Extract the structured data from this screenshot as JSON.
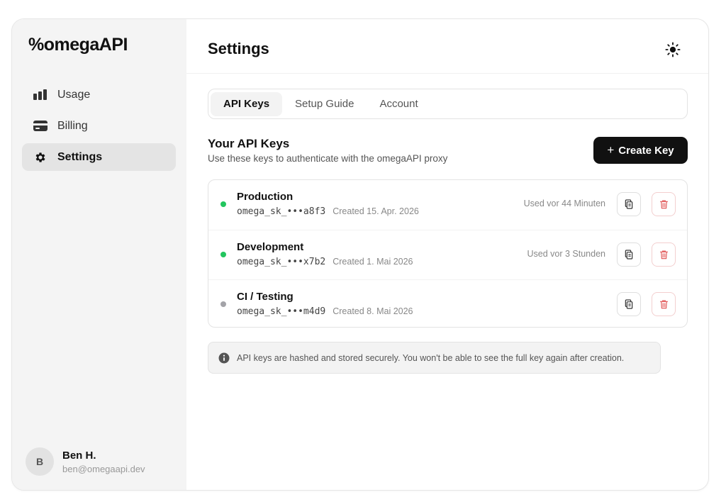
{
  "app": {
    "logo": "%omegaAPI"
  },
  "sidebar": {
    "items": [
      {
        "label": "Usage",
        "icon": "bar-chart-icon",
        "active": false
      },
      {
        "label": "Billing",
        "icon": "credit-card-icon",
        "active": false
      },
      {
        "label": "Settings",
        "icon": "gear-icon",
        "active": true
      }
    ],
    "user": {
      "initial": "B",
      "name": "Ben H.",
      "email": "ben@omegaapi.dev"
    }
  },
  "header": {
    "title": "Settings",
    "theme_icon": "sun-icon"
  },
  "tabs": [
    {
      "label": "API Keys",
      "active": true
    },
    {
      "label": "Setup Guide",
      "active": false
    },
    {
      "label": "Account",
      "active": false
    }
  ],
  "api_keys": {
    "title": "Your API Keys",
    "subtitle": "Use these keys to authenticate with the omegaAPI proxy",
    "create_label": "Create Key",
    "create_icon": "+",
    "keys": [
      {
        "name": "Production",
        "mask": "omega_sk_•••a8f3",
        "created": "Created 15. Apr. 2026",
        "used": "Used vor 44 Minuten",
        "status_color": "#22c55e"
      },
      {
        "name": "Development",
        "mask": "omega_sk_•••x7b2",
        "created": "Created 1. Mai 2026",
        "used": "Used vor 3 Stunden",
        "status_color": "#22c55e"
      },
      {
        "name": "CI / Testing",
        "mask": "omega_sk_•••m4d9",
        "created": "Created 8. Mai 2026",
        "used": "",
        "status_color": "#a3a3a8"
      }
    ]
  },
  "notice": {
    "icon": "info-icon",
    "text": "API keys are hashed and stored securely. You won't be able to see the full key again after creation."
  },
  "colors": {
    "accent": "#111111",
    "danger": "#e05252",
    "success": "#22c55e",
    "sidebar_bg": "#f4f4f4"
  }
}
